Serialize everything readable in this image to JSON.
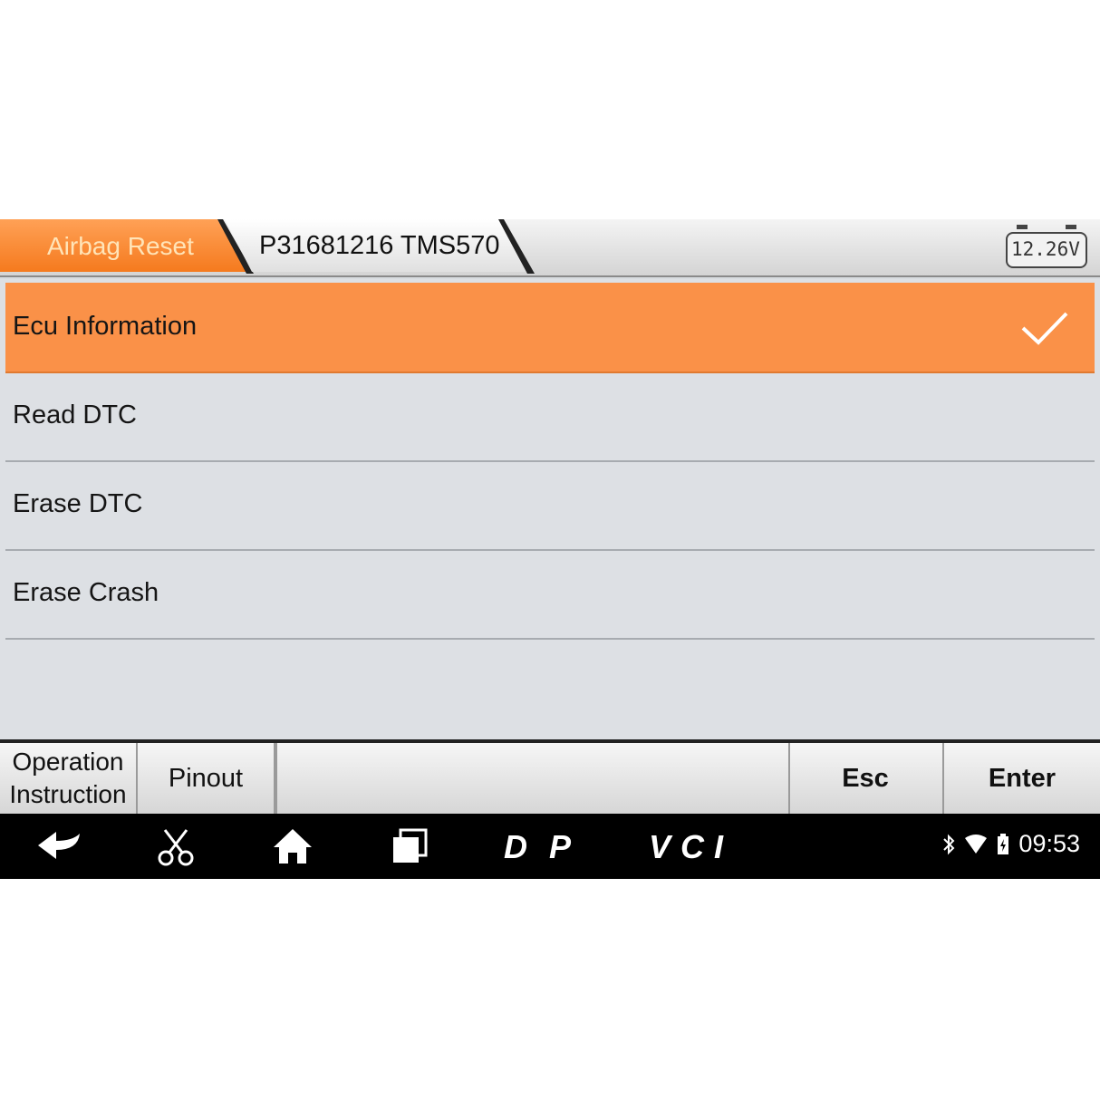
{
  "breadcrumb": {
    "items": [
      "Airbag Reset",
      "P31681216 TMS570"
    ]
  },
  "battery": {
    "voltage": "12.26V"
  },
  "menu": {
    "items": [
      {
        "label": "Ecu Information",
        "selected": true
      },
      {
        "label": "Read DTC",
        "selected": false
      },
      {
        "label": "Erase DTC",
        "selected": false
      },
      {
        "label": "Erase Crash",
        "selected": false
      }
    ]
  },
  "actions": {
    "operation_instruction_line1": "Operation",
    "operation_instruction_line2": "Instruction",
    "pinout": "Pinout",
    "esc": "Esc",
    "enter": "Enter"
  },
  "navbar": {
    "icons": [
      "back-icon",
      "scissors-icon",
      "home-icon",
      "recent-apps-icon",
      "dp-logo",
      "vci-logo"
    ],
    "dp_text": "DP",
    "vci_text": "VCI"
  },
  "status": {
    "time": "09:53",
    "icons": [
      "bluetooth-icon",
      "wifi-icon",
      "battery-icon"
    ]
  },
  "colors": {
    "accent": "#fa9148",
    "tab_active": "#f57a1e",
    "navbar": "#000000"
  }
}
